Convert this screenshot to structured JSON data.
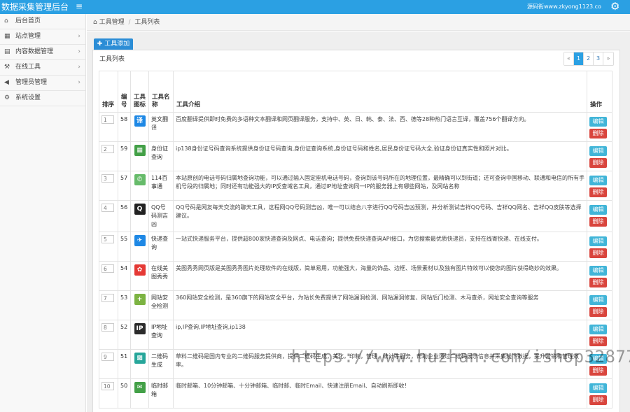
{
  "header": {
    "title": "数据采集管理后台",
    "menu_icon": "hamburger-icon",
    "source_text": "源码街www.zkyong1123.co",
    "settings_icon": "gear-icon"
  },
  "sidebar": {
    "items": [
      {
        "label": "后台首页",
        "icon": "home-icon",
        "has_children": false
      },
      {
        "label": "站点管理",
        "icon": "grid-icon",
        "has_children": true
      },
      {
        "label": "内容数据管理",
        "icon": "document-icon",
        "has_children": true
      },
      {
        "label": "在线工具",
        "icon": "wrench-icon",
        "has_children": true
      },
      {
        "label": "管理员管理",
        "icon": "megaphone-icon",
        "has_children": true
      },
      {
        "label": "系统设置",
        "icon": "cog-icon",
        "has_children": false
      }
    ]
  },
  "breadcrumb": {
    "home": "工具管理",
    "sep": "/",
    "current": "工具列表"
  },
  "toolbar": {
    "add_label": "工具添加"
  },
  "panel": {
    "title": "工具列表"
  },
  "pagination": {
    "prev": "«",
    "pages": [
      "1",
      "2",
      "3"
    ],
    "current": "1",
    "next": "»"
  },
  "table": {
    "headers": {
      "sort": "排序",
      "id": "编号",
      "icon": "工具图标",
      "name": "工具名称",
      "intro": "工具介绍",
      "actions": "操作"
    },
    "edit_label": "编辑",
    "delete_label": "删除",
    "rows": [
      {
        "sort": "1",
        "id": "58",
        "icon_char": "译",
        "icon_color": "#1e88e5",
        "name": "英文翻译",
        "intro": "百度翻译提供即时免费的多语种文本翻译和网页翻译服务，支持中、英、日、韩、泰、法、西、德等28种热门语言互译，覆盖756个翻译方向。"
      },
      {
        "sort": "2",
        "id": "59",
        "icon_char": "▦",
        "icon_color": "#43a047",
        "name": "身份证查询",
        "intro": "ip138身份证号码查询系统提供身份证号码查询,身份证查询系统,身份证号码和姓名,居民身份证号码大全,验证身份证真实性和照片对比。"
      },
      {
        "sort": "3",
        "id": "57",
        "icon_char": "✆",
        "icon_color": "#66bb6a",
        "name": "114百事通",
        "intro": "本站原创的电话号码归属地查询功能，可以通过输入固定座机电话号码，查询到该号码所在的地理位置，最精确可以到街道；还可查询中国移动、联通和电信的所有手机号段的归属地；同时还有功能强大的IP反查域名工具，通过IP地址查询同一IP的服务器上有哪些网站，及网站名称"
      },
      {
        "sort": "4",
        "id": "56",
        "icon_char": "Q",
        "icon_color": "#222222",
        "name": "QQ号码测吉凶",
        "intro": "QQ号码是网友每天交流的聊天工具，这程网QQ号码测吉凶，唯一可以结合八字进行QQ号码吉凶预测，并分析测试吉祥QQ号码、吉祥QQ网名、吉祥QQ皮肤等选择建议。"
      },
      {
        "sort": "5",
        "id": "55",
        "icon_char": "✈",
        "icon_color": "#1e88e5",
        "name": "快递查询",
        "intro": "一站式快递服务平台，提供超800家快递查询及网点、电话查询；提供免费快递查询API接口，为您搜索最优质快递员，支持在线寄快递、在线支付。"
      },
      {
        "sort": "6",
        "id": "54",
        "icon_char": "✿",
        "icon_color": "#e53935",
        "name": "在线美图秀秀",
        "intro": "美图秀秀网页版是美图秀秀图片处理软件的在线版，简单易用，功能强大，海量的饰品、边框、场景素材以及独有图片特效可以使您的图片获得绝妙的效果。"
      },
      {
        "sort": "7",
        "id": "53",
        "icon_char": "+",
        "icon_color": "#7cb342",
        "name": "网站安全检测",
        "intro": "360网站安全检测，是360旗下的网站安全平台，为站长免费提供了网站漏洞检测、网站漏洞修复、网站后门检测、木马查杀，网址安全查询等服务"
      },
      {
        "sort": "8",
        "id": "52",
        "icon_char": "IP",
        "icon_color": "#2b2b2b",
        "name": "IP地址查询",
        "intro": "ip,IP查询,IP地址查询,ip138"
      },
      {
        "sort": "9",
        "id": "51",
        "icon_char": "▩",
        "icon_color": "#26a69a",
        "name": "二维码生成",
        "intro": "草料二维码是国内专业的二维码服务提供商，提供二维码生成，美化，印制，管理，统计等服务，帮助企业通过二维码展示信息并采集线下数据，提升营销和管理效率。"
      },
      {
        "sort": "10",
        "id": "50",
        "icon_char": "✉",
        "icon_color": "#43a047",
        "name": "临时邮箱",
        "intro": "临时邮箱、10分钟邮箱、十分钟邮箱、临时邮、临时Email、快速注册Email、自动刷新即收！"
      }
    ]
  },
  "watermark": "https://www.huzhan.com/ishop32877"
}
